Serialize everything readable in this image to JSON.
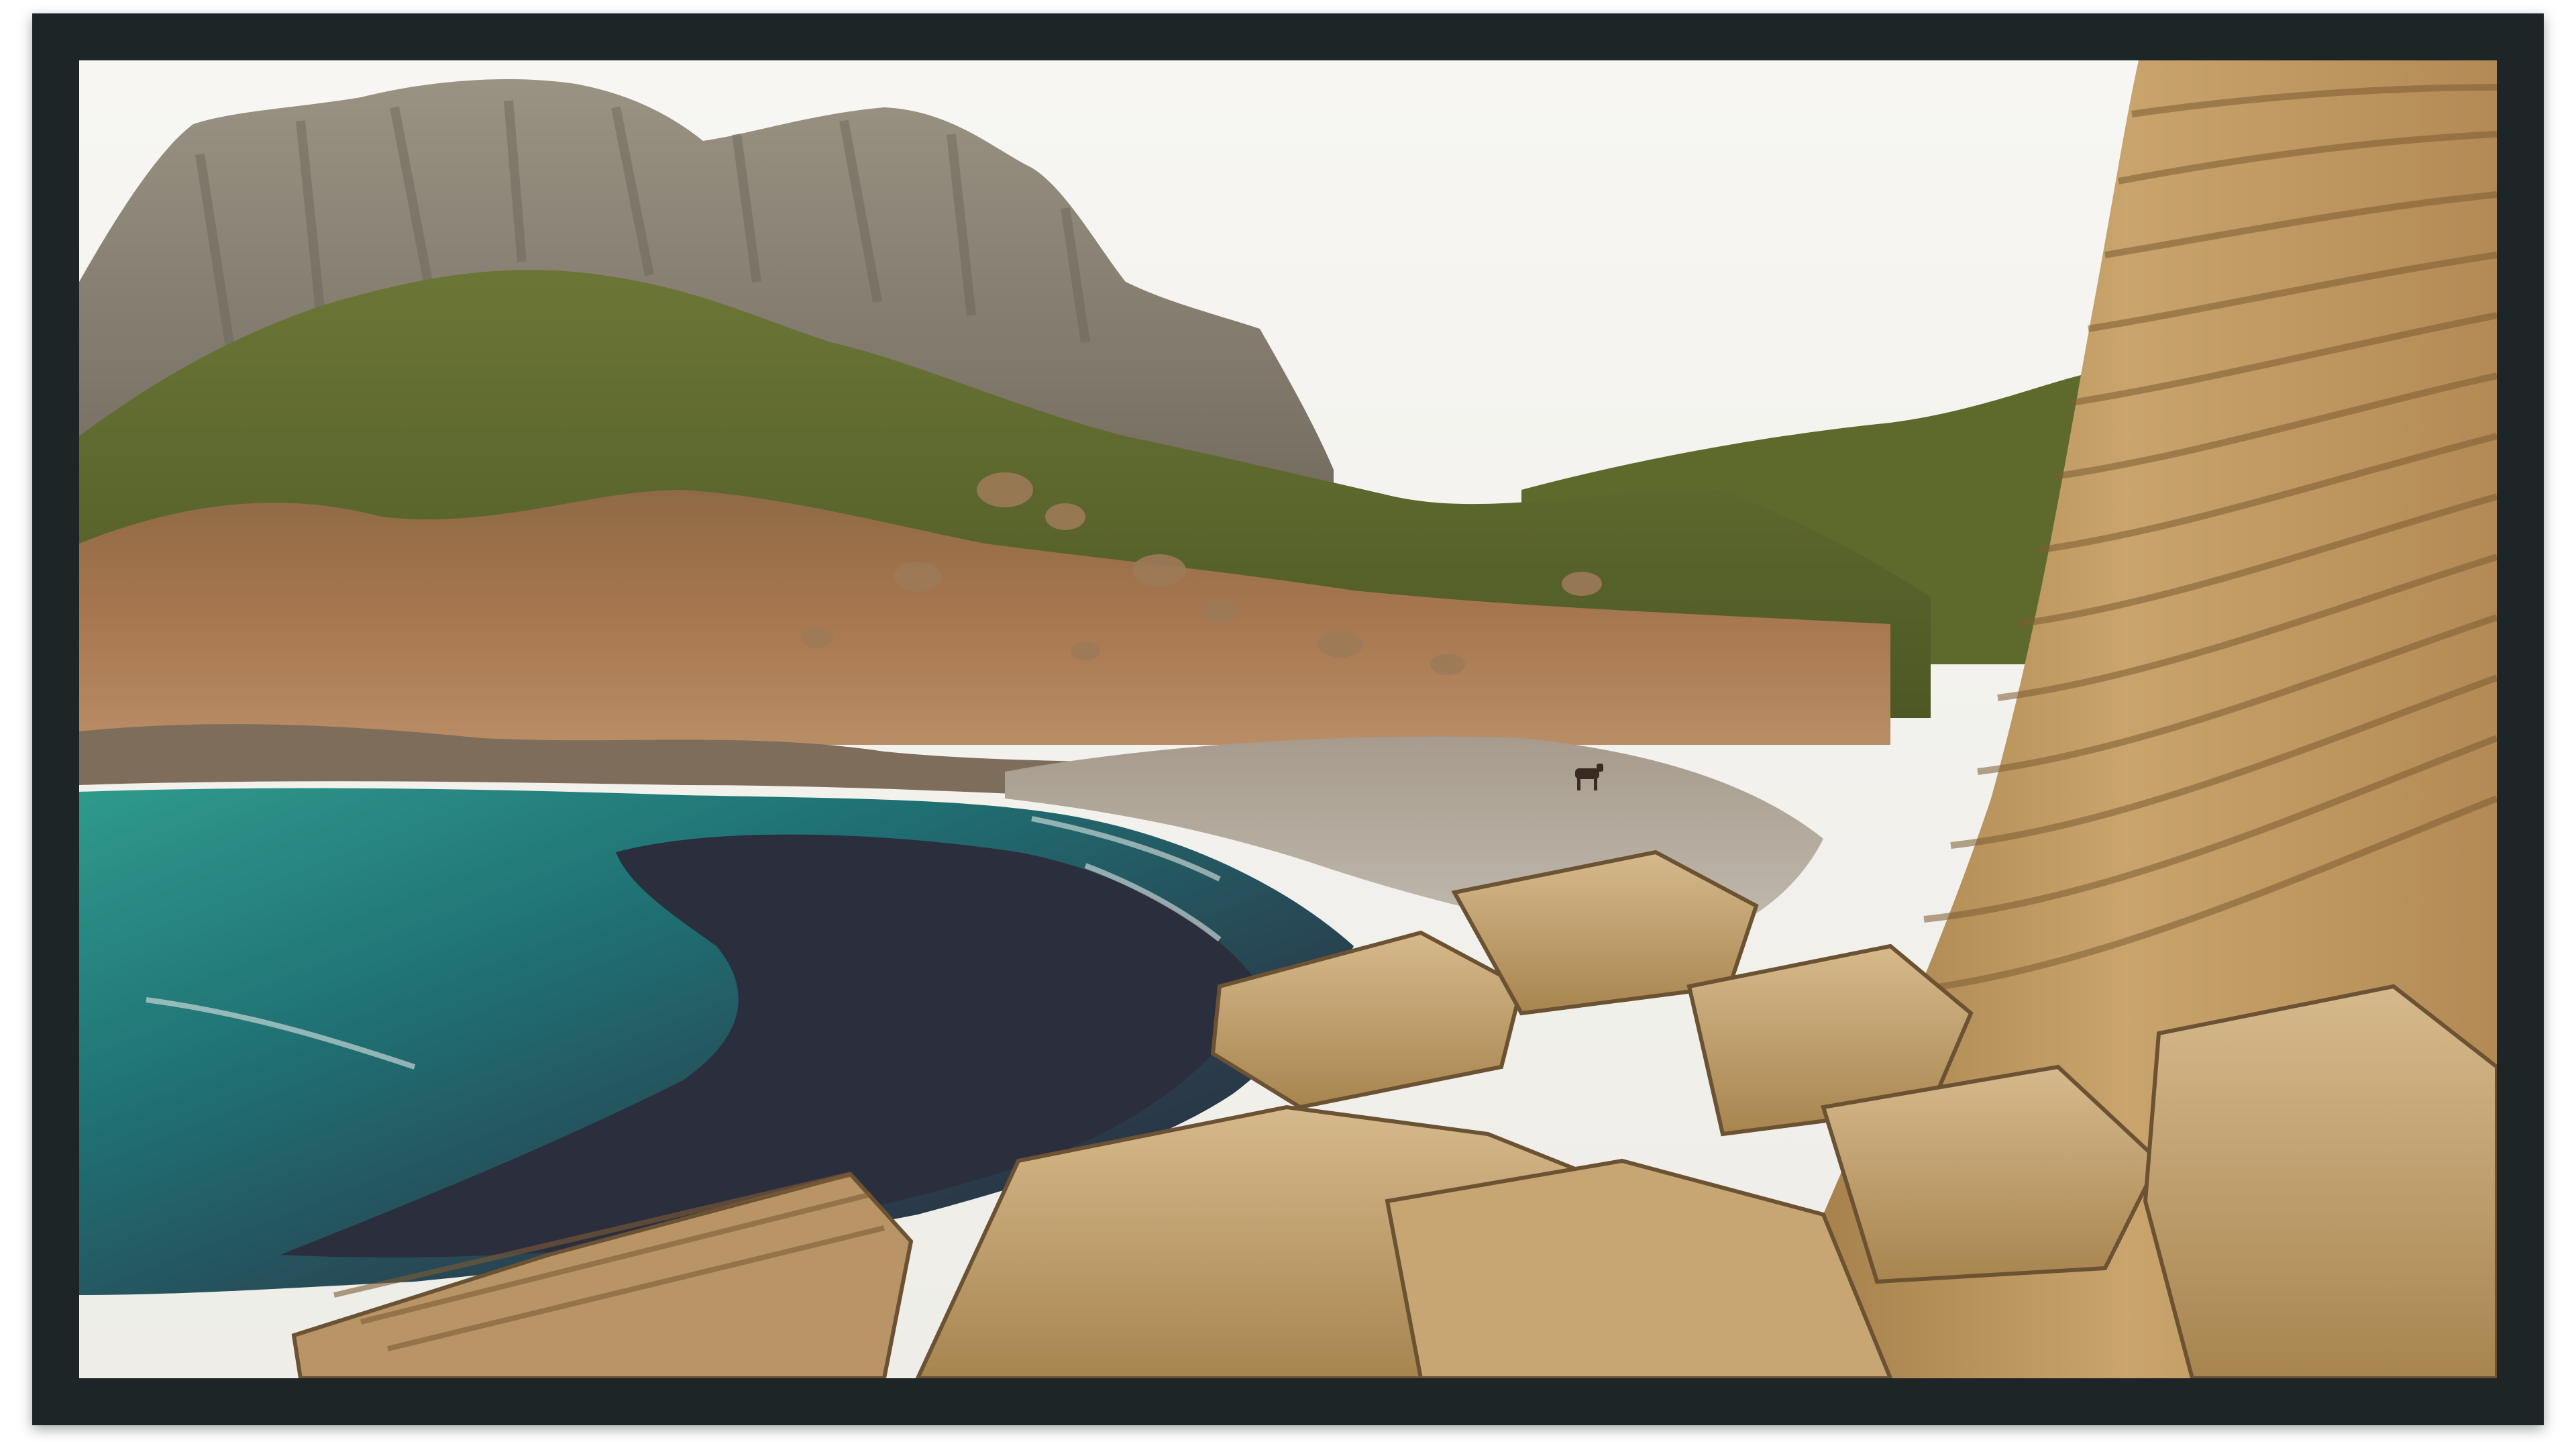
{
  "image": {
    "subject": "rocky-cove-landscape",
    "colors": {
      "frame": "#1d2526",
      "sky": "#f3f2ee",
      "mountain": "#8f8676",
      "vegetation": "#5f6b2e",
      "slope": "#a7774f",
      "water_turquoise": "#2f8c86",
      "water_dark": "#2c2f3f",
      "rock_layered": "#c9a46c",
      "pebble_beach": "#b8b2a8"
    }
  }
}
